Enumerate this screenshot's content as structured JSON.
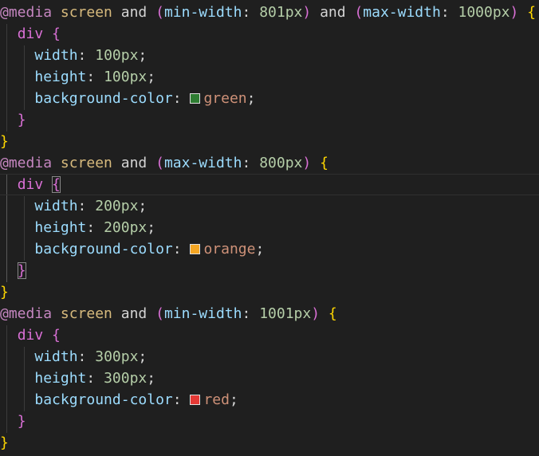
{
  "code": {
    "blocks": [
      {
        "at": "@",
        "media": "media",
        "screen": "screen",
        "and1": "and",
        "cond1_open": "(",
        "cond1_prop": "min-width",
        "cond1_colon": ": ",
        "cond1_val": "801px",
        "cond1_close": ")",
        "and2": "and",
        "cond2_open": "(",
        "cond2_prop": "max-width",
        "cond2_colon": ": ",
        "cond2_val": "1000px",
        "cond2_close": ")",
        "open_brace": "{",
        "selector": "div",
        "sel_open": "{",
        "width_prop": "width",
        "width_val": "100px",
        "height_prop": "height",
        "height_val": "100px",
        "bg_prop": "background-color",
        "bg_val": "green",
        "swatch_color": "#2e7d32",
        "sel_close": "}",
        "close_brace": "}"
      },
      {
        "at": "@",
        "media": "media",
        "screen": "screen",
        "and1": "and",
        "cond1_open": "(",
        "cond1_prop": "max-width",
        "cond1_colon": ": ",
        "cond1_val": "800px",
        "cond1_close": ")",
        "open_brace": "{",
        "selector": "div",
        "sel_open": "{",
        "width_prop": "width",
        "width_val": "200px",
        "height_prop": "height",
        "height_val": "200px",
        "bg_prop": "background-color",
        "bg_val": "orange",
        "swatch_color": "#f5a623",
        "sel_close": "}",
        "close_brace": "}"
      },
      {
        "at": "@",
        "media": "media",
        "screen": "screen",
        "and1": "and",
        "cond1_open": "(",
        "cond1_prop": "min-width",
        "cond1_colon": ": ",
        "cond1_val": "1001px",
        "cond1_close": ")",
        "open_brace": "{",
        "selector": "div",
        "sel_open": "{",
        "width_prop": "width",
        "width_val": "300px",
        "height_prop": "height",
        "height_val": "300px",
        "bg_prop": "background-color",
        "bg_val": "red",
        "swatch_color": "#e53935",
        "sel_close": "}",
        "close_brace": "}"
      }
    ],
    "semicolon": ";",
    "colon": ": "
  },
  "colors": {
    "background": "#1f1f1f",
    "bracket_level1": "#ffd700",
    "bracket_level2": "#da70d6",
    "bracket_level3": "#179fff",
    "keyword": "#c586c0",
    "property": "#9cdcfe",
    "number": "#b5cea8",
    "string_value": "#ce9178"
  }
}
